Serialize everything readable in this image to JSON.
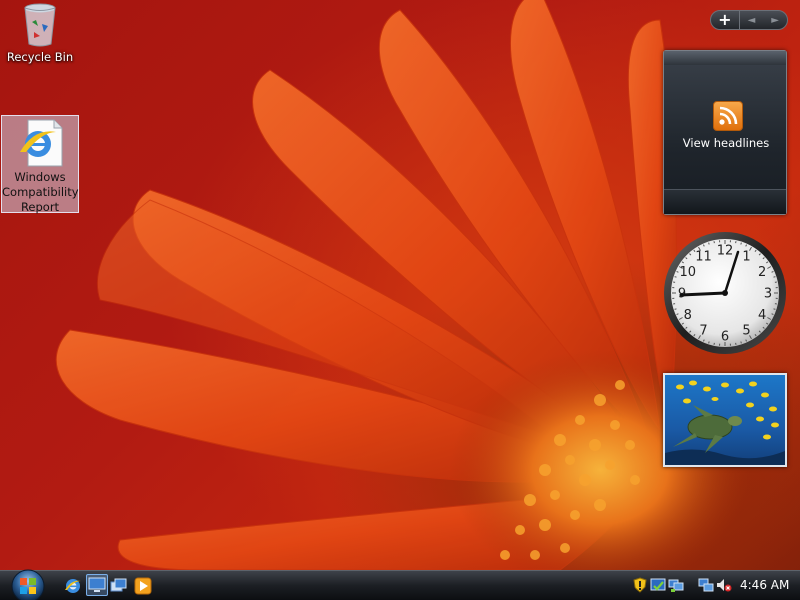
{
  "desktop": {
    "icons": [
      {
        "label": "Recycle Bin",
        "icon": "recycle-bin-icon"
      },
      {
        "label_lines": [
          "Windows",
          "Compatibility",
          "Report"
        ],
        "icon": "internet-explorer-document-icon",
        "selected": true
      }
    ]
  },
  "sidebar": {
    "controls": {
      "add": "+",
      "prev": "◄",
      "next": "►"
    },
    "feed_gadget": {
      "label": "View headlines",
      "icon": "rss-feed-icon"
    },
    "clock_gadget": {
      "time_shown": "9:04",
      "numerals": [
        "12",
        "1",
        "2",
        "3",
        "4",
        "5",
        "6",
        "7",
        "8",
        "9",
        "10",
        "11"
      ]
    },
    "slideshow_gadget": {
      "subject": "sea turtle with tropical fish"
    }
  },
  "taskbar": {
    "start_icon": "windows-orb-icon",
    "quick_launch": [
      "internet-explorer-icon",
      "show-desktop-icon",
      "switch-windows-icon",
      "media-player-icon"
    ],
    "tray_icons": [
      "security-shield-icon",
      "windows-update-icon",
      "network-icon",
      "network-connection-icon",
      "volume-muted-icon"
    ],
    "clock": "4:46 AM"
  },
  "colors": {
    "wallpaper": "#b21b12",
    "petal": "#e04a14",
    "taskbar": "#1c1f24",
    "feed_orange": "#f08a24"
  }
}
